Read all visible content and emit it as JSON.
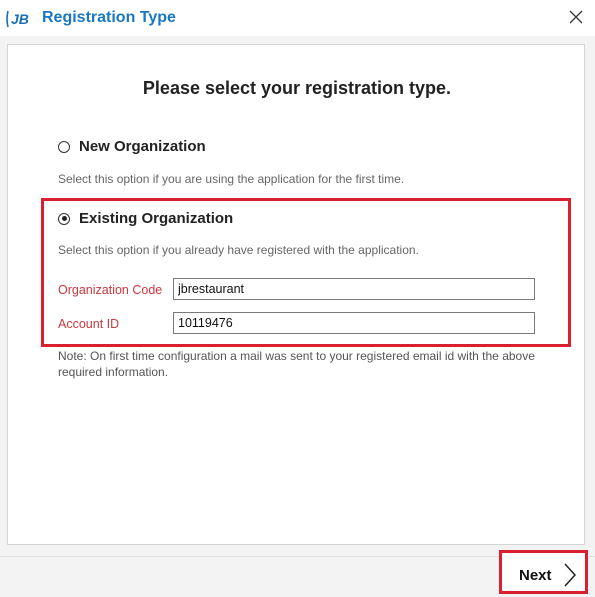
{
  "window": {
    "title": "Registration Type",
    "logo_text": "JB",
    "close_icon": "close-icon"
  },
  "main": {
    "heading": "Please select your registration type.",
    "options": [
      {
        "label": "New Organization",
        "description": "Select this option if you are using the application for the first time.",
        "selected": false
      },
      {
        "label": "Existing Organization",
        "description": "Select this option if you already have registered with the application.",
        "selected": true
      }
    ],
    "fields": {
      "org_code_label": "Organization Code",
      "org_code_value": "jbrestaurant",
      "account_id_label": "Account ID",
      "account_id_value": "10119476"
    },
    "note": "Note: On first time configuration a mail was sent to your registered email id with the above required information."
  },
  "footer": {
    "next_label": "Next"
  },
  "colors": {
    "title": "#1a78c2",
    "highlight": "#d9202c",
    "field_label": "#c8383d"
  }
}
